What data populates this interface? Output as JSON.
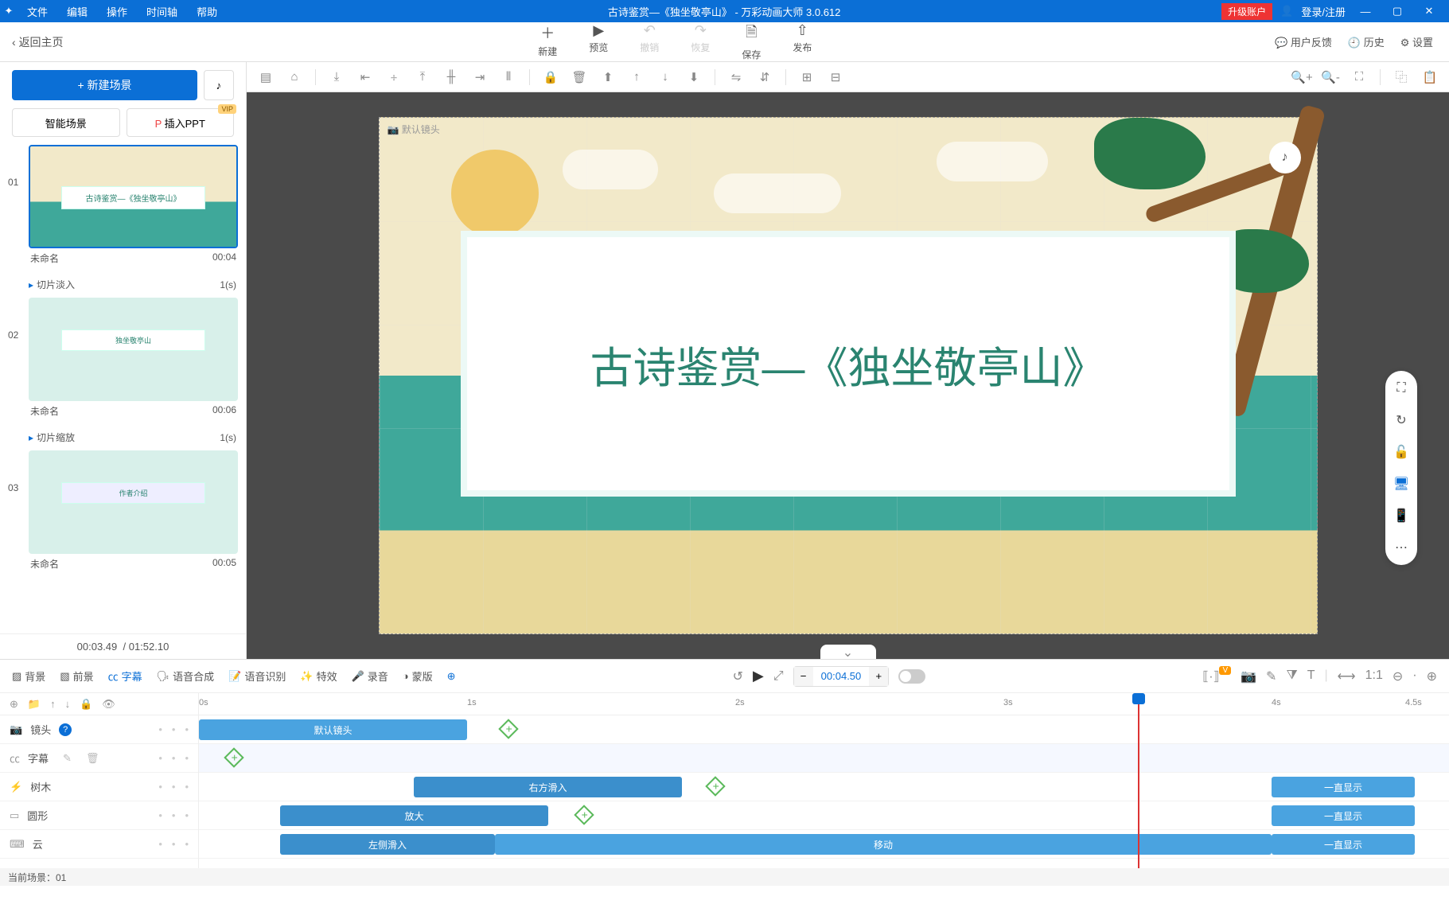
{
  "titlebar": {
    "menus": [
      "文件",
      "编辑",
      "操作",
      "时间轴",
      "帮助"
    ],
    "title": "古诗鉴赏—《独坐敬亭山》 - 万彩动画大师 3.0.612",
    "upgrade": "升级账户",
    "login": "登录/注册"
  },
  "toolbar": {
    "back": "返回主页",
    "new": "新建",
    "preview": "预览",
    "undo": "撤销",
    "redo": "恢复",
    "save": "保存",
    "publish": "发布",
    "feedback": "用户反馈",
    "history": "历史",
    "settings": "设置"
  },
  "left": {
    "newscene": "+  新建场景",
    "smartscene": "智能场景",
    "importppt": "插入PPT",
    "vip": "VIP",
    "scenes": [
      {
        "num": "01",
        "name": "未命名",
        "dur": "00:04",
        "thumb_text": "古诗鉴赏—《独坐敬亭山》",
        "trans": "切片淡入",
        "trans_dur": "1(s)",
        "selected": true
      },
      {
        "num": "02",
        "name": "未命名",
        "dur": "00:06",
        "thumb_text": "独坐敬亭山",
        "trans": "切片缩放",
        "trans_dur": "1(s)",
        "selected": false
      },
      {
        "num": "03",
        "name": "未命名",
        "dur": "00:05",
        "thumb_text": "作者介绍",
        "trans": "",
        "trans_dur": "",
        "selected": false
      }
    ],
    "time_current": "00:03.49",
    "time_total": "01:52.10"
  },
  "canvas": {
    "camlabel": "默认镜头",
    "maintext": "古诗鉴赏—《独坐敬亭山》"
  },
  "timeline": {
    "tabs": {
      "bg": "背景",
      "fg": "前景",
      "subtitle": "字幕",
      "tts": "语音合成",
      "asr": "语音识别",
      "fx": "特效",
      "record": "录音",
      "mask": "蒙版"
    },
    "timecode": "00:04.50",
    "ruler": [
      "0s",
      "1s",
      "2s",
      "3s",
      "4s",
      "4.5s"
    ],
    "tracks": [
      {
        "icon": "📷",
        "name": "镜头",
        "help": true
      },
      {
        "icon": "㏄",
        "name": "字幕"
      },
      {
        "icon": "⚡",
        "name": "树木"
      },
      {
        "icon": "▭",
        "name": "圆形"
      },
      {
        "icon": "⌨",
        "name": "云"
      }
    ],
    "clips": {
      "camera": "默认镜头",
      "tree_in": "右方滑入",
      "tree_keep": "一直显示",
      "circle_in": "放大",
      "circle_keep": "一直显示",
      "cloud_in": "左侧滑入",
      "cloud_move": "移动",
      "cloud_keep": "一直显示"
    },
    "vbadge": "V"
  },
  "footer": {
    "current": "当前场景：01"
  }
}
